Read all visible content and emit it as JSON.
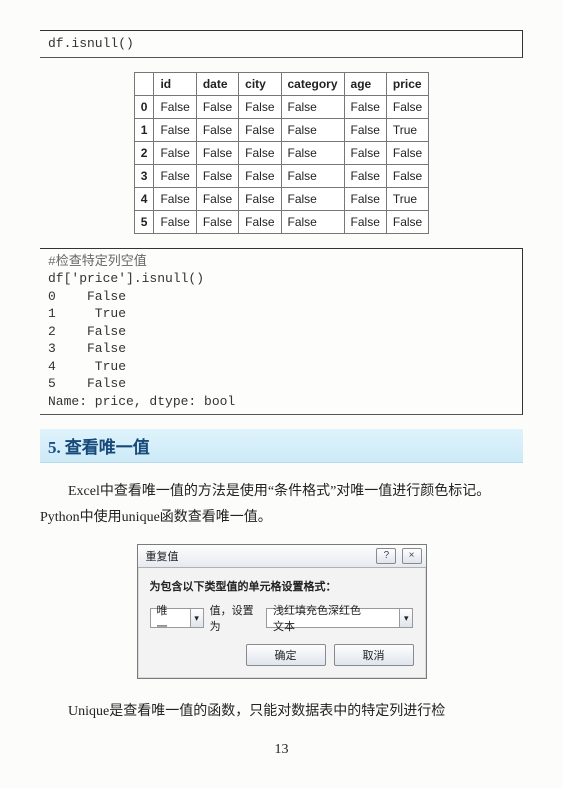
{
  "code1": "df.isnull()",
  "table": {
    "headers": [
      "id",
      "date",
      "city",
      "category",
      "age",
      "price"
    ],
    "rows": [
      {
        "idx": "0",
        "cells": [
          "False",
          "False",
          "False",
          "False",
          "False",
          "False"
        ]
      },
      {
        "idx": "1",
        "cells": [
          "False",
          "False",
          "False",
          "False",
          "False",
          "True"
        ]
      },
      {
        "idx": "2",
        "cells": [
          "False",
          "False",
          "False",
          "False",
          "False",
          "False"
        ]
      },
      {
        "idx": "3",
        "cells": [
          "False",
          "False",
          "False",
          "False",
          "False",
          "False"
        ]
      },
      {
        "idx": "4",
        "cells": [
          "False",
          "False",
          "False",
          "False",
          "False",
          "True"
        ]
      },
      {
        "idx": "5",
        "cells": [
          "False",
          "False",
          "False",
          "False",
          "False",
          "False"
        ]
      }
    ]
  },
  "code2": {
    "comment": "#检查特定列空值",
    "line": "df['price'].isnull()",
    "out": "\n0    False\n1     True\n2    False\n3    False\n4     True\n5    False\nName: price, dtype: bool"
  },
  "section": {
    "num": "5.",
    "title": "查看唯一值"
  },
  "para1": "Excel中查看唯一值的方法是使用“条件格式”对唯一值进行颜色标记。Python中使用unique函数查看唯一值。",
  "dialog": {
    "title": "重复值",
    "help": "?",
    "close": "×",
    "label": "为包含以下类型值的单元格设置格式：",
    "combo1": "唯一",
    "mid": "值，设置为",
    "combo2": "浅红填充色深红色文本",
    "ok": "确定",
    "cancel": "取消"
  },
  "para2": "Unique是查看唯一值的函数，只能对数据表中的特定列进行检",
  "pagenum": "13"
}
